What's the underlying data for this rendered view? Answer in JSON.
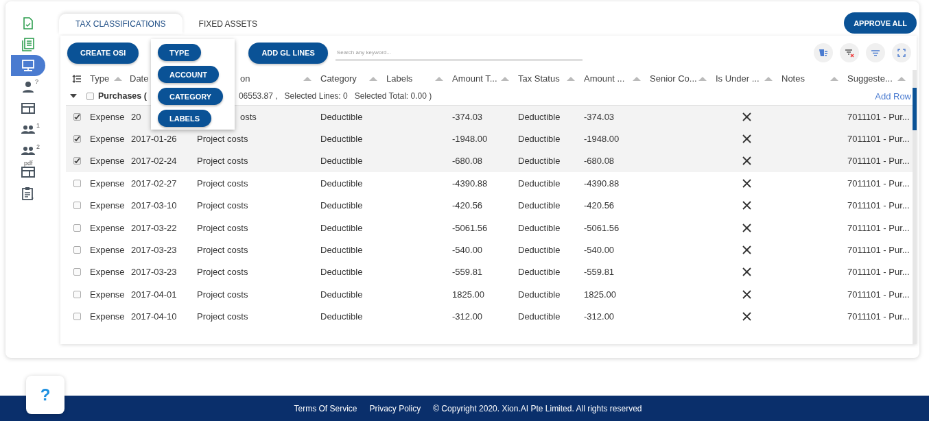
{
  "sidebar": {
    "items": [
      {
        "kind": "doc-check",
        "selected": false
      },
      {
        "kind": "list",
        "selected": false
      },
      {
        "kind": "monitor",
        "selected": true
      },
      {
        "kind": "person",
        "selected": false,
        "badge": "?"
      },
      {
        "kind": "layout",
        "selected": false
      },
      {
        "kind": "group",
        "selected": false,
        "badge": "1"
      },
      {
        "kind": "group",
        "selected": false,
        "badge": "2"
      },
      {
        "kind": "layout",
        "selected": false,
        "badge": "pdf"
      },
      {
        "kind": "clipboard",
        "selected": false
      }
    ]
  },
  "tabs": [
    {
      "label": "TAX CLASSIFICATIONS",
      "selected": true
    },
    {
      "label": "FIXED ASSETS",
      "selected": false
    }
  ],
  "approve_button": "APPROVE ALL",
  "toolbar": {
    "buttons": [
      "CREATE OSI",
      "ADD GL LINES"
    ],
    "search": {
      "placeholder": "Search any keyword..."
    }
  },
  "column_menu": {
    "items": [
      "TYPE",
      "ACCOUNT",
      "CATEGORY",
      "LABELS"
    ]
  },
  "table": {
    "columns": [
      "Type",
      "Date",
      "on",
      "Category",
      "Labels",
      "Amount T...",
      "Tax Status",
      "Amount ...",
      "Senior Co...",
      "Is Under ...",
      "Notes",
      "Suggeste..."
    ],
    "group": {
      "expanded": true,
      "checked": false,
      "name": "Purchases (",
      "summary": "06553.87 ,",
      "selected_lines": "Selected Lines: 0",
      "selected_total": "Selected Total: 0.00 )",
      "add_row": "Add Row"
    },
    "rows": [
      {
        "checked": true,
        "type": "Expense",
        "date": "20",
        "description": "osts",
        "category": "Deductible",
        "amount_t": "-374.03",
        "tax_status": "Deductible",
        "amount": "-374.03",
        "is_under": false,
        "suggested": "7011101 - Pur..."
      },
      {
        "checked": true,
        "type": "Expense",
        "date": "2017-01-26",
        "description": "Project costs",
        "category": "Deductible",
        "amount_t": "-1948.00",
        "tax_status": "Deductible",
        "amount": "-1948.00",
        "is_under": false,
        "suggested": "7011101 - Pur..."
      },
      {
        "checked": true,
        "type": "Expense",
        "date": "2017-02-24",
        "description": "Project costs",
        "category": "Deductible",
        "amount_t": "-680.08",
        "tax_status": "Deductible",
        "amount": "-680.08",
        "is_under": false,
        "suggested": "7011101 - Pur..."
      },
      {
        "checked": false,
        "type": "Expense",
        "date": "2017-02-27",
        "description": "Project costs",
        "category": "Deductible",
        "amount_t": "-4390.88",
        "tax_status": "Deductible",
        "amount": "-4390.88",
        "is_under": false,
        "suggested": "7011101 - Pur..."
      },
      {
        "checked": false,
        "type": "Expense",
        "date": "2017-03-10",
        "description": "Project costs",
        "category": "Deductible",
        "amount_t": "-420.56",
        "tax_status": "Deductible",
        "amount": "-420.56",
        "is_under": false,
        "suggested": "7011101 - Pur..."
      },
      {
        "checked": false,
        "type": "Expense",
        "date": "2017-03-22",
        "description": "Project costs",
        "category": "Deductible",
        "amount_t": "-5061.56",
        "tax_status": "Deductible",
        "amount": "-5061.56",
        "is_under": false,
        "suggested": "7011101 - Pur..."
      },
      {
        "checked": false,
        "type": "Expense",
        "date": "2017-03-23",
        "description": "Project costs",
        "category": "Deductible",
        "amount_t": "-540.00",
        "tax_status": "Deductible",
        "amount": "-540.00",
        "is_under": false,
        "suggested": "7011101 - Pur..."
      },
      {
        "checked": false,
        "type": "Expense",
        "date": "2017-03-23",
        "description": "Project costs",
        "category": "Deductible",
        "amount_t": "-559.81",
        "tax_status": "Deductible",
        "amount": "-559.81",
        "is_under": false,
        "suggested": "7011101 - Pur..."
      },
      {
        "checked": false,
        "type": "Expense",
        "date": "2017-04-01",
        "description": "Project costs",
        "category": "Deductible",
        "amount_t": "1825.00",
        "tax_status": "Deductible",
        "amount": "1825.00",
        "is_under": false,
        "suggested": "7011101 - Pur..."
      },
      {
        "checked": false,
        "type": "Expense",
        "date": "2017-04-10",
        "description": "Project costs",
        "category": "Deductible",
        "amount_t": "-312.00",
        "tax_status": "Deductible",
        "amount": "-312.00",
        "is_under": false,
        "suggested": "7011101 - Pur..."
      }
    ]
  },
  "help_button": "?",
  "footer": {
    "links": [
      "Terms Of Service",
      "Privacy Policy"
    ],
    "copyright": "© Copyright 2020. Xion.AI Pte Limited. All rights reserved"
  }
}
